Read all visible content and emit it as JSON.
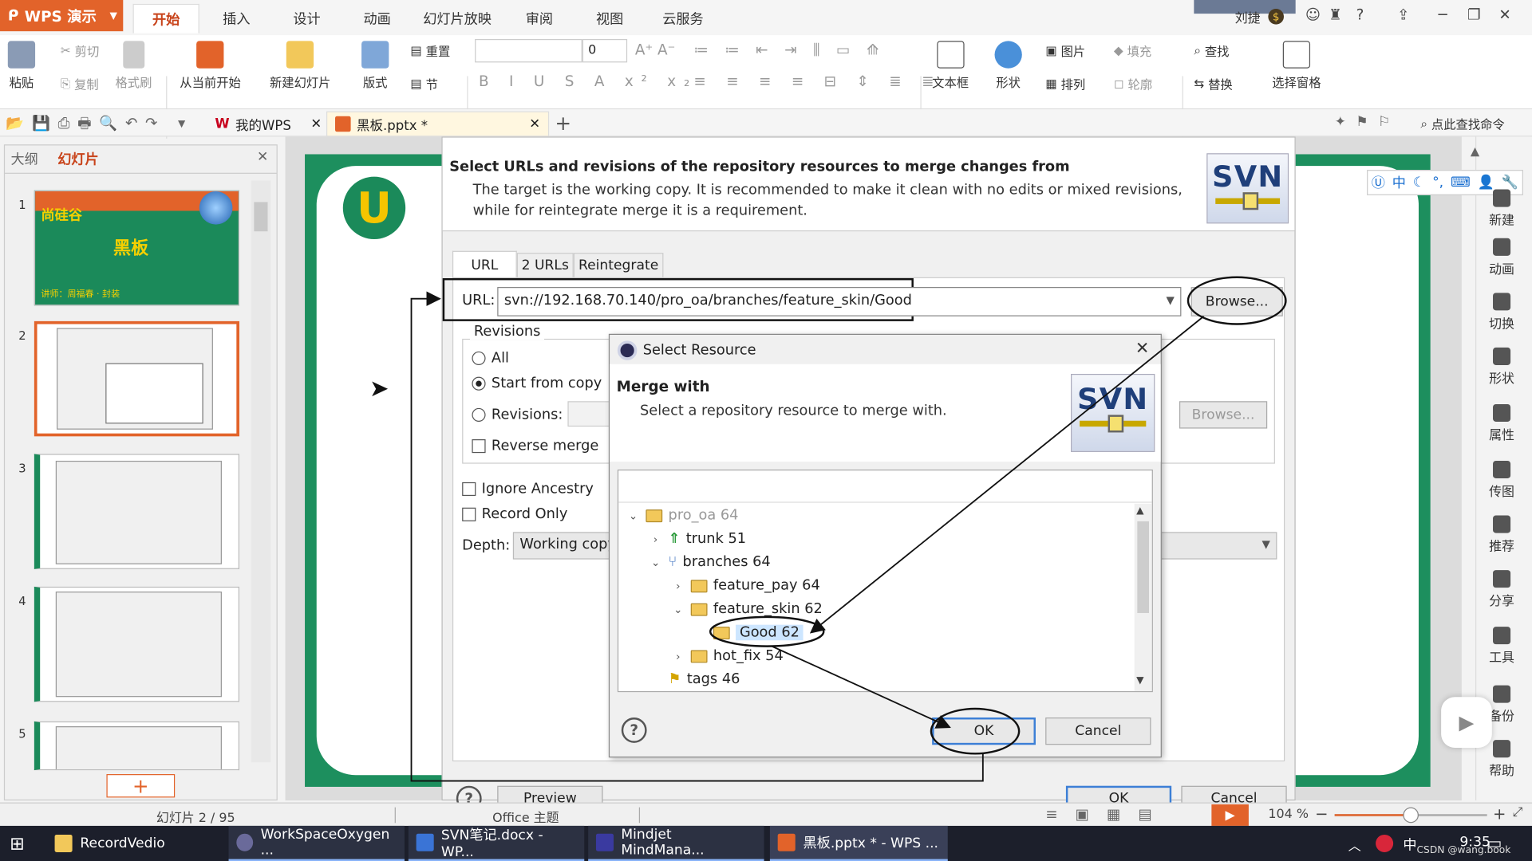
{
  "app": {
    "name": "WPS 演示",
    "menu_tabs": [
      "开始",
      "插入",
      "设计",
      "动画",
      "幻灯片放映",
      "审阅",
      "视图",
      "云服务"
    ],
    "active_tab": "开始",
    "user": "刘捷"
  },
  "ribbon": {
    "paste": "粘贴",
    "cut": "剪切",
    "copy": "复制",
    "format_painter": "格式刷",
    "from_current": "从当前开始",
    "new_slide": "新建幻灯片",
    "layout": "版式",
    "reset": "重置",
    "section": "节",
    "font_size": "0",
    "textbox": "文本框",
    "shape": "形状",
    "picture": "图片",
    "fill": "填充",
    "arrange": "排列",
    "outline": "轮廓",
    "find": "查找",
    "replace": "替换",
    "select_pane": "选择窗格"
  },
  "qat": {
    "tab_wps": "我的WPS",
    "tab_file": "黑板.pptx *",
    "search": "点此查找命令"
  },
  "leftpanel": {
    "tab_outline": "大纲",
    "tab_slides": "幻灯片",
    "slide_numbers": [
      "1",
      "2",
      "3",
      "4",
      "5"
    ],
    "slide1_logo": "尚硅谷",
    "slide1_title": "黑板",
    "slide1_sub": "讲师：周福春 · 封装"
  },
  "righttoolbar": [
    "新建",
    "动画",
    "切换",
    "形状",
    "属性",
    "传图",
    "推荐",
    "分享",
    "工具",
    "备份",
    "帮助"
  ],
  "merge_dialog": {
    "heading": "Select URLs and revisions of the repository resources to merge changes from",
    "desc_line1": "The target is the working copy. It is recommended to make it clean with no edits or mixed revisions,",
    "desc_line2": "while for reintegrate merge it is a requirement.",
    "logo": "SVN",
    "tabs": [
      "URL",
      "2 URLs",
      "Reintegrate"
    ],
    "url_label": "URL:",
    "url_value": "svn://192.168.70.140/pro_oa/branches/feature_skin/Good",
    "browse": "Browse...",
    "revisions_group": "Revisions",
    "opt_all": "All",
    "opt_start": "Start from copy",
    "opt_revisions": "Revisions:",
    "reverse_merge": "Reverse merge",
    "ignore_ancestry": "Ignore Ancestry",
    "record_only": "Record Only",
    "depth_label": "Depth:",
    "depth_value": "Working copy",
    "help": "?",
    "preview": "Preview",
    "ok": "OK",
    "cancel": "Cancel"
  },
  "select_resource": {
    "title": "Select Resource",
    "heading": "Merge with",
    "desc": "Select a repository resource to merge with.",
    "logo": "SVN",
    "tree": [
      {
        "label": "pro_oa 64",
        "level": 0,
        "chev": "v",
        "dim": true
      },
      {
        "label": "trunk 51",
        "level": 1,
        "chev": ">"
      },
      {
        "label": "branches 64",
        "level": 1,
        "chev": "v"
      },
      {
        "label": "feature_pay 64",
        "level": 2,
        "chev": ">"
      },
      {
        "label": "feature_skin 62",
        "level": 2,
        "chev": "v"
      },
      {
        "label": "Good 62",
        "level": 3,
        "chev": ""
      },
      {
        "label": "hot_fix 54",
        "level": 2,
        "chev": ">"
      },
      {
        "label": "tags 46",
        "level": 1,
        "chev": ""
      }
    ],
    "help": "?",
    "ok": "OK",
    "cancel": "Cancel"
  },
  "status": {
    "slide_pos": "幻灯片 2 / 95",
    "theme": "Office 主题",
    "zoom": "104 %"
  },
  "taskbar": {
    "items": [
      "RecordVedio",
      "WorkSpaceOxygen ...",
      "SVN笔记.docx - WP...",
      "Mindjet MindMana...",
      "黑板.pptx * - WPS ..."
    ],
    "ime": "中",
    "time": "9:35",
    "watermark": "CSDN @wang.book"
  }
}
